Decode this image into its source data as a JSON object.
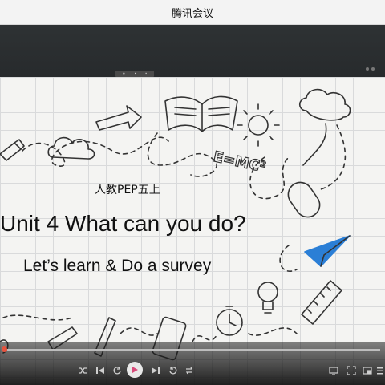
{
  "app": {
    "title": "腾讯会议"
  },
  "slide": {
    "subtitle": "人教PEP五上",
    "headline": "Unit 4 What can you do?",
    "headline2": "Let’s learn & Do a survey",
    "doodle_formula": "E=MC²"
  },
  "player": {
    "progress": 0.01,
    "accent_color": "#e04a3a",
    "buttons": [
      "shuffle-icon",
      "previous-icon",
      "rewind-icon",
      "play-icon",
      "next-icon",
      "forward-icon",
      "cast-icon",
      "fullscreen-icon",
      "picture-in-picture-icon",
      "menu-icon"
    ]
  },
  "colors": {
    "titlebar_bg": "#f3f3f3",
    "stage_bg": "#202224",
    "slide_bg": "#f4f4f2"
  }
}
